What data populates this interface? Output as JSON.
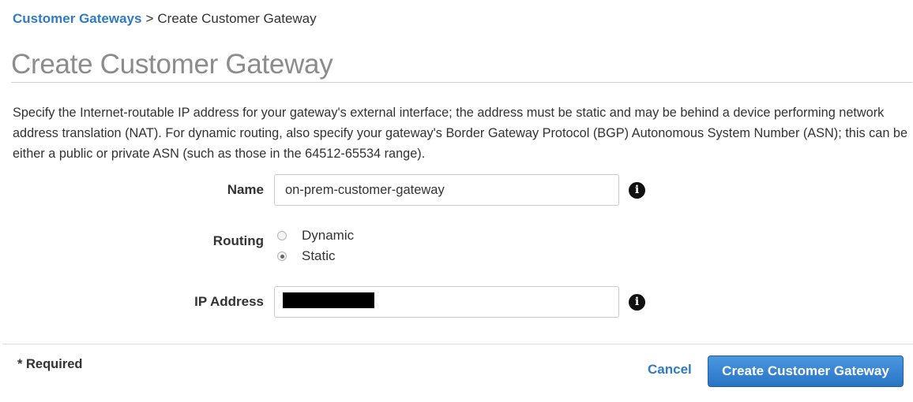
{
  "breadcrumb": {
    "parent": "Customer Gateways",
    "separator": ">",
    "current": "Create Customer Gateway"
  },
  "page_title": "Create Customer Gateway",
  "description": "Specify the Internet-routable IP address for your gateway's external interface; the address must be static and may be behind a device performing network address translation (NAT). For dynamic routing, also specify your gateway's Border Gateway Protocol (BGP) Autonomous System Number (ASN); this can be either a public or private ASN (such as those in the 64512-65534 range).",
  "form": {
    "name": {
      "label": "Name",
      "value": "on-prem-customer-gateway",
      "icon": "info-icon"
    },
    "routing": {
      "label": "Routing",
      "options": [
        {
          "label": "Dynamic",
          "checked": false
        },
        {
          "label": "Static",
          "checked": true
        }
      ]
    },
    "ip_address": {
      "label": "IP Address",
      "value": "",
      "redacted": true,
      "icon": "info-icon"
    }
  },
  "footer": {
    "required_note": "* Required",
    "cancel_label": "Cancel",
    "create_label": "Create Customer Gateway"
  },
  "colors": {
    "link": "#2f7bc4",
    "title": "#8c8c8c",
    "primary_button": "#2a74c5"
  }
}
